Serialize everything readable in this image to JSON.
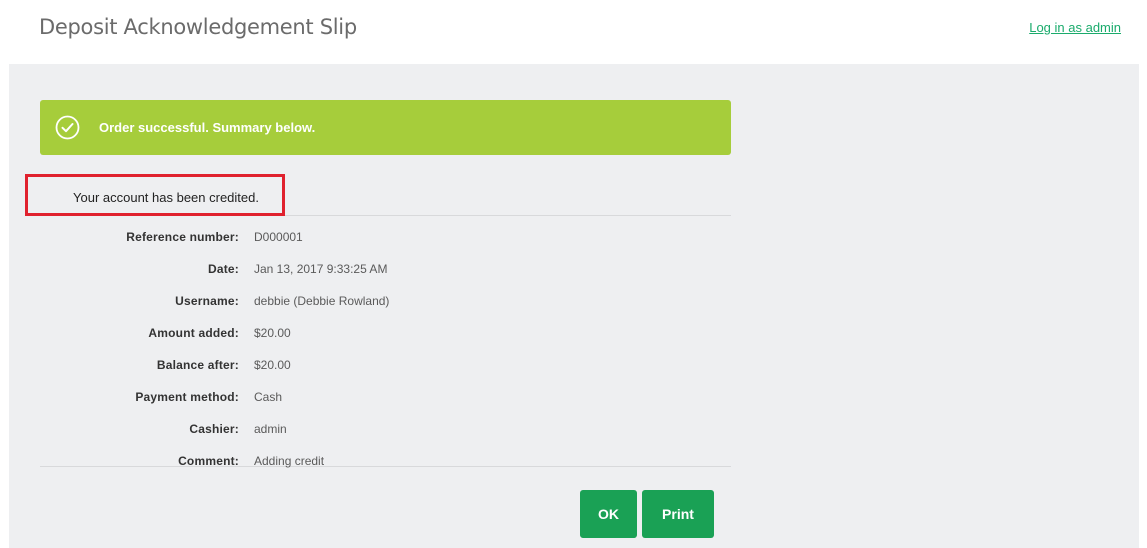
{
  "header": {
    "title": "Deposit Acknowledgement Slip",
    "admin_link": "Log in as admin"
  },
  "alert": {
    "message": "Order successful. Summary below.",
    "icon": "check-circle-icon"
  },
  "credited_message": "Your account has been credited.",
  "details": [
    {
      "label": "Reference number:",
      "value": "D000001"
    },
    {
      "label": "Date:",
      "value": "Jan 13, 2017 9:33:25 AM"
    },
    {
      "label": "Username:",
      "value": "debbie (Debbie Rowland)"
    },
    {
      "label": "Amount added:",
      "value": "$20.00"
    },
    {
      "label": "Balance after:",
      "value": "$20.00"
    },
    {
      "label": "Payment method:",
      "value": "Cash"
    },
    {
      "label": "Cashier:",
      "value": "admin"
    },
    {
      "label": "Comment:",
      "value": "Adding credit"
    }
  ],
  "buttons": {
    "ok": "OK",
    "print": "Print"
  },
  "colors": {
    "alert_bg": "#a6cd3b",
    "button_bg": "#1aa155",
    "link": "#1aab6c",
    "highlight": "#e0212e"
  }
}
